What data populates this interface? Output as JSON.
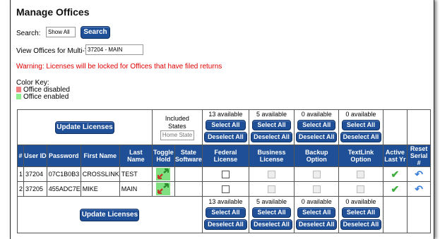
{
  "page": {
    "title": "Manage Offices",
    "search_label": "Search:",
    "search_value": "Show All",
    "search_button": "Search",
    "multitier_label": "View Offices for Multi-Tier",
    "multitier_value": "37204 - MAIN",
    "warning": "Warning: Licenses will be locked for Offices that have filed returns",
    "color_key": {
      "label": "Color Key:",
      "items": [
        {
          "label": "Office disabled",
          "color": "#f08080"
        },
        {
          "label": "Office enabled",
          "color": "#90ee90"
        }
      ]
    }
  },
  "table": {
    "update_button": "Update Licenses",
    "included_states": "Included States",
    "home_state_placeholder": "Home State",
    "select_all": "Select All",
    "deselect_all": "Deselect All",
    "columns": {
      "num": "#",
      "user_id": "User ID",
      "password": "Password",
      "first_name": "First Name",
      "last_name": "Last Name",
      "toggle_hold": "Toggle Hold",
      "state_software": "State Software",
      "federal": "Federal License",
      "business": "Business License",
      "backup": "Backup Option",
      "textlink": "TextLink Option",
      "active": "Active Last Yr",
      "reset": "Reset Serial #"
    },
    "available": {
      "federal": "13 available",
      "business": "5 available",
      "backup": "0 available",
      "textlink": "0 available"
    },
    "rows": [
      {
        "num": "1",
        "user_id": "37204",
        "password": "07C1B0B3",
        "first_name": "CROSSLINK",
        "last_name": "TEST"
      },
      {
        "num": "2",
        "user_id": "37205",
        "password": "455ADC7E",
        "first_name": "MIKE",
        "last_name": "MAIN"
      }
    ]
  }
}
